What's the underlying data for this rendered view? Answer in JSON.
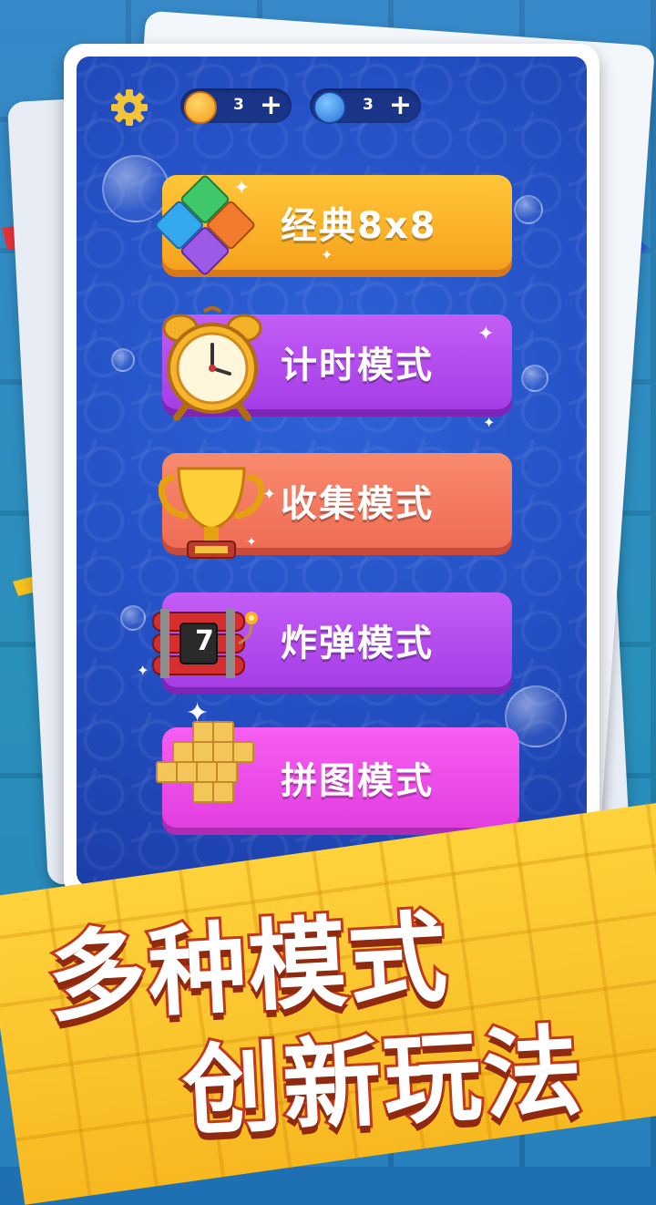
{
  "topbar": {
    "gold_count": "3",
    "blue_count": "3",
    "plus": "+"
  },
  "modes": [
    {
      "label": "经典8x8"
    },
    {
      "label": "计时模式"
    },
    {
      "label": "收集模式"
    },
    {
      "label": "炸弹模式",
      "badge": "7"
    },
    {
      "label": "拼图模式"
    }
  ],
  "slogan": {
    "line1": "多种模式",
    "line2": "创新玩法"
  },
  "colors": {
    "panel_blue": "#2450c4",
    "classic": "#f6a21c",
    "timed": "#a53ee6",
    "collect": "#ef6c54",
    "bomb": "#a53ee6",
    "puzzle": "#e23ee0",
    "banner": "#f7b820",
    "slogan_stroke": "#c0391b"
  },
  "icons": [
    "gear-icon",
    "gold-coin-icon",
    "blue-gem-coin-icon",
    "blocks-icon",
    "alarm-clock-icon",
    "trophy-icon",
    "dynamite-icon",
    "puzzle-blocks-icon"
  ]
}
